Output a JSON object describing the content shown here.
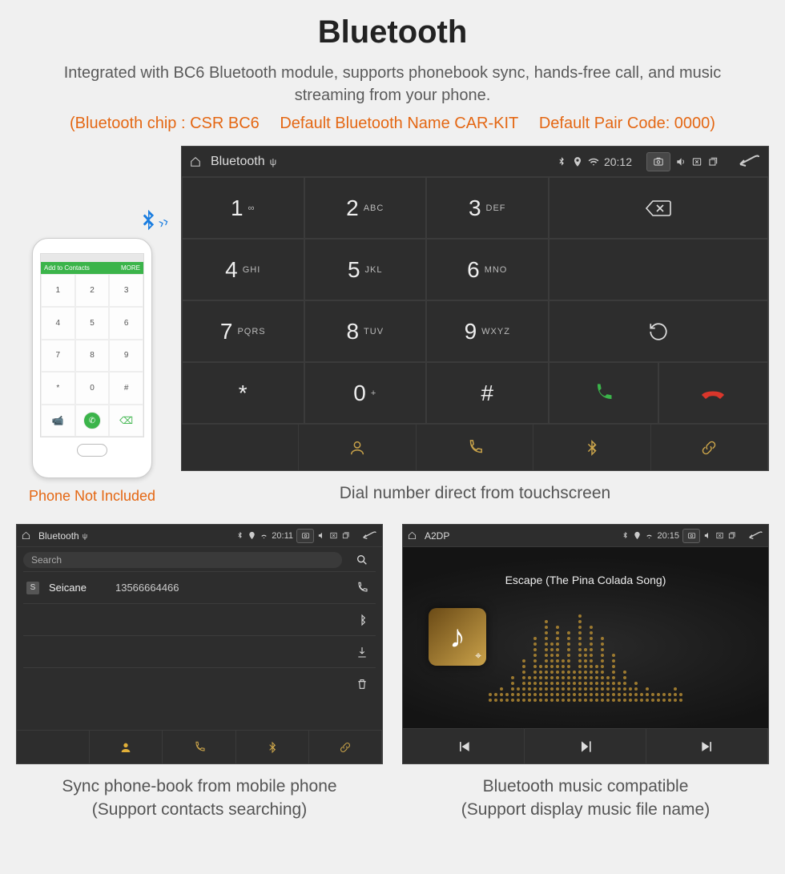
{
  "header": {
    "title": "Bluetooth",
    "subtitle": "Integrated with BC6 Bluetooth module, supports phonebook sync, hands-free call, and music streaming from your phone.",
    "spec_chip": "(Bluetooth chip : CSR BC6",
    "spec_name": "Default Bluetooth Name CAR-KIT",
    "spec_code": "Default Pair Code: 0000)"
  },
  "phone": {
    "add_contacts": "Add to Contacts",
    "more": "MORE",
    "caption": "Phone Not Included",
    "keys": [
      "1",
      "2",
      "3",
      "4",
      "5",
      "6",
      "7",
      "8",
      "9",
      "*",
      "0",
      "#"
    ]
  },
  "dialer": {
    "status": {
      "title": "Bluetooth",
      "time": "20:12"
    },
    "keys": [
      {
        "n": "1",
        "s": "∞"
      },
      {
        "n": "2",
        "s": "ABC"
      },
      {
        "n": "3",
        "s": "DEF"
      },
      {
        "n": "4",
        "s": "GHI"
      },
      {
        "n": "5",
        "s": "JKL"
      },
      {
        "n": "6",
        "s": "MNO"
      },
      {
        "n": "7",
        "s": "PQRS"
      },
      {
        "n": "8",
        "s": "TUV"
      },
      {
        "n": "9",
        "s": "WXYZ"
      },
      {
        "n": "*",
        "s": ""
      },
      {
        "n": "0",
        "s": "+"
      },
      {
        "n": "#",
        "s": ""
      }
    ],
    "caption": "Dial number direct from touchscreen"
  },
  "phonebook": {
    "status": {
      "title": "Bluetooth",
      "time": "20:11"
    },
    "search_placeholder": "Search",
    "contact": {
      "initial": "S",
      "name": "Seicane",
      "number": "13566664466"
    },
    "caption_line1": "Sync phone-book from mobile phone",
    "caption_line2": "(Support contacts searching)"
  },
  "a2dp": {
    "status": {
      "title": "A2DP",
      "time": "20:15"
    },
    "song": "Escape (The Pina Colada Song)",
    "caption_line1": "Bluetooth music compatible",
    "caption_line2": "(Support display music file name)"
  }
}
